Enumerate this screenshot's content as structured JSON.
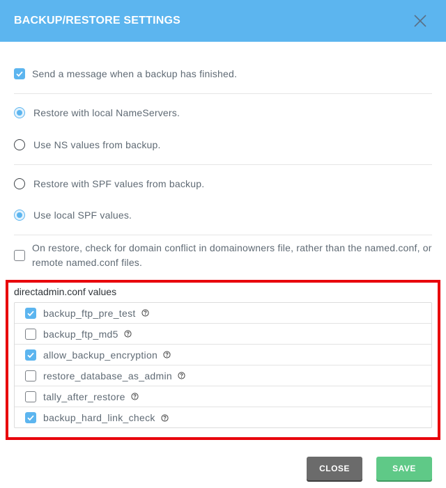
{
  "dialog": {
    "title": "BACKUP/RESTORE SETTINGS",
    "close_icon": "close-icon"
  },
  "options": {
    "send_message": {
      "label": "Send a message when a backup has finished.",
      "checked": true
    },
    "nameservers": [
      {
        "label": "Restore with local NameServers.",
        "selected": true
      },
      {
        "label": "Use NS values from backup.",
        "selected": false
      }
    ],
    "spf": [
      {
        "label": "Restore with SPF values from backup.",
        "selected": false
      },
      {
        "label": "Use local SPF values.",
        "selected": true
      }
    ],
    "domain_conflict": {
      "label": "On restore, check for domain conflict in domainowners file, rather than the named.conf, or remote named.conf files.",
      "checked": false
    }
  },
  "directadmin_conf": {
    "title": "directadmin.conf values",
    "items": [
      {
        "label": "backup_ftp_pre_test",
        "checked": true
      },
      {
        "label": "backup_ftp_md5",
        "checked": false
      },
      {
        "label": "allow_backup_encryption",
        "checked": true
      },
      {
        "label": "restore_database_as_admin",
        "checked": false
      },
      {
        "label": "tally_after_restore",
        "checked": false
      },
      {
        "label": "backup_hard_link_check",
        "checked": true
      }
    ]
  },
  "footer": {
    "close_label": "CLOSE",
    "save_label": "SAVE"
  },
  "colors": {
    "header": "#5cb5ef",
    "accent": "#5cb5ef",
    "highlight_border": "#e8000b",
    "close_button": "#6b6b6b",
    "save_button": "#5fc987"
  }
}
